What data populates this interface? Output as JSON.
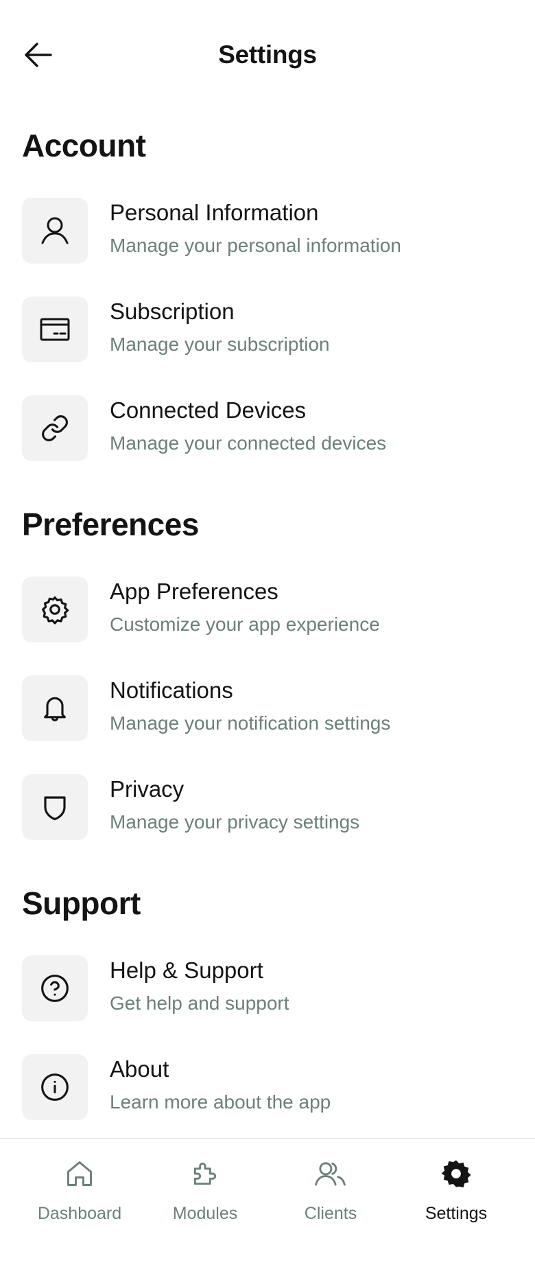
{
  "header": {
    "title": "Settings",
    "back_icon": "arrow-left-icon"
  },
  "sections": [
    {
      "title": "Account",
      "items": [
        {
          "title": "Personal Information",
          "subtitle": "Manage your personal information",
          "icon": "user-icon"
        },
        {
          "title": "Subscription",
          "subtitle": "Manage your subscription",
          "icon": "credit-card-icon"
        },
        {
          "title": "Connected Devices",
          "subtitle": "Manage your connected devices",
          "icon": "link-icon"
        }
      ]
    },
    {
      "title": "Preferences",
      "items": [
        {
          "title": "App Preferences",
          "subtitle": "Customize your app experience",
          "icon": "gear-icon"
        },
        {
          "title": "Notifications",
          "subtitle": "Manage your notification settings",
          "icon": "bell-icon"
        },
        {
          "title": "Privacy",
          "subtitle": "Manage your privacy settings",
          "icon": "shield-icon"
        }
      ]
    },
    {
      "title": "Support",
      "items": [
        {
          "title": "Help & Support",
          "subtitle": "Get help and support",
          "icon": "help-circle-icon"
        },
        {
          "title": "About",
          "subtitle": "Learn more about the app",
          "icon": "info-circle-icon"
        }
      ]
    }
  ],
  "bottom_nav": {
    "active": "Settings",
    "items": [
      {
        "label": "Dashboard",
        "icon": "home-icon"
      },
      {
        "label": "Modules",
        "icon": "puzzle-icon"
      },
      {
        "label": "Clients",
        "icon": "users-icon"
      },
      {
        "label": "Settings",
        "icon": "gear-filled-icon"
      }
    ]
  },
  "colors": {
    "text": "#141414",
    "muted": "#6b8079",
    "icon_bg": "#f1f2f1",
    "divider": "#ebeeec"
  }
}
